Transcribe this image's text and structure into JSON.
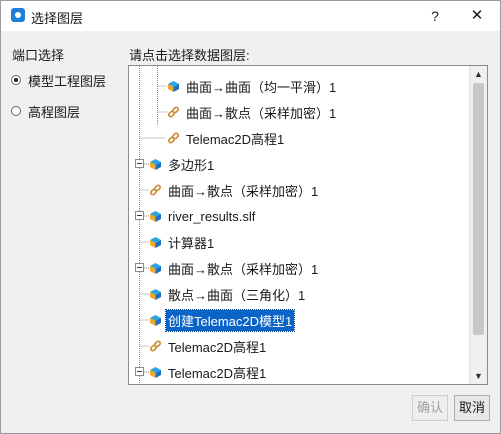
{
  "titlebar": {
    "title": "选择图层",
    "help": "?",
    "close": "✕"
  },
  "left": {
    "label": "端口选择",
    "options": [
      {
        "label": "模型工程图层",
        "checked": true
      },
      {
        "label": "高程图层",
        "checked": false
      }
    ]
  },
  "tree": {
    "label": "请点击选择数据图层:",
    "rows": [
      {
        "text": "曲面→曲面（均一平滑）1",
        "icon": "layer-cube-icon"
      },
      {
        "text": "曲面→散点（采样加密）1",
        "icon": "link-icon"
      },
      {
        "text": "Telemac2D高程1",
        "icon": "link-icon"
      },
      {
        "text": "多边形1",
        "icon": "layer-cube-icon"
      },
      {
        "text": "曲面→散点（采样加密）1",
        "icon": "link-icon"
      },
      {
        "text": "river_results.slf",
        "icon": "layer-cube-icon"
      },
      {
        "text": "计算器1",
        "icon": "layer-cube-icon"
      },
      {
        "text": "曲面→散点（采样加密）1",
        "icon": "layer-cube-icon"
      },
      {
        "text": "散点→曲面（三角化）1",
        "icon": "layer-cube-icon"
      },
      {
        "text": "创建Telemac2D模型1",
        "icon": "layer-cube-icon",
        "selected": true
      },
      {
        "text": "Telemac2D高程1",
        "icon": "link-icon"
      },
      {
        "text": "Telemac2D高程1",
        "icon": "layer-cube-icon"
      }
    ]
  },
  "scrollbar": {
    "up": "▲",
    "down": "▼"
  },
  "buttons": {
    "ok": "确认",
    "cancel": "取消"
  }
}
